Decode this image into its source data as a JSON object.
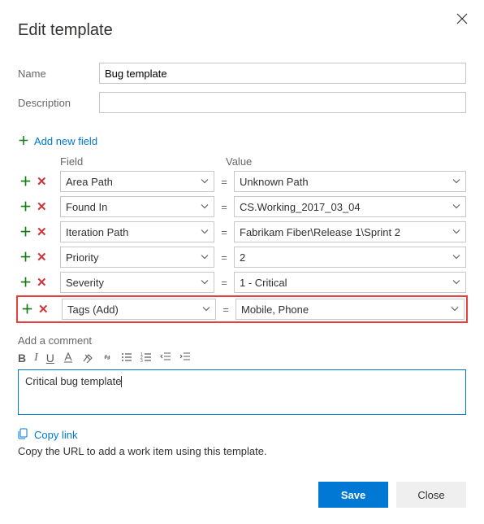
{
  "dialog": {
    "title": "Edit template",
    "close_aria": "Close"
  },
  "form": {
    "name_label": "Name",
    "name_value": "Bug template",
    "description_label": "Description",
    "description_value": ""
  },
  "add_new_field_label": "Add new field",
  "headers": {
    "field": "Field",
    "value": "Value"
  },
  "rows": [
    {
      "field": "Area Path",
      "value": "Unknown Path"
    },
    {
      "field": "Found In",
      "value": "CS.Working_2017_03_04"
    },
    {
      "field": "Iteration Path",
      "value": "Fabrikam Fiber\\Release 1\\Sprint 2"
    },
    {
      "field": "Priority",
      "value": "2"
    },
    {
      "field": "Severity",
      "value": "1 - Critical"
    },
    {
      "field": "Tags (Add)",
      "value": "Mobile, Phone",
      "highlighted": true
    }
  ],
  "equals": "=",
  "comment": {
    "label": "Add a comment",
    "text": "Critical bug template"
  },
  "toolbar": {
    "bold": "B",
    "italic": "I",
    "underline": "U"
  },
  "copy": {
    "link_label": "Copy link",
    "help": "Copy the URL to add a work item using this template."
  },
  "buttons": {
    "save": "Save",
    "close": "Close"
  }
}
